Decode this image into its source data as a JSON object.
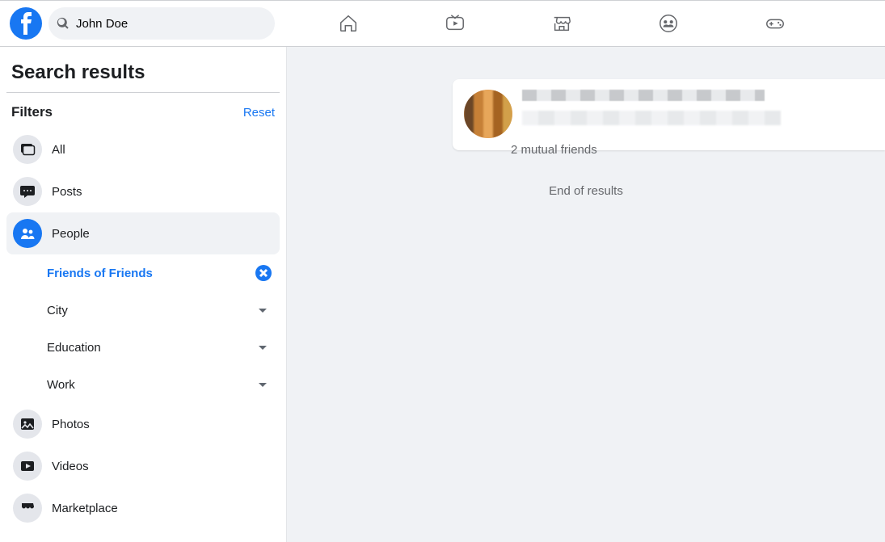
{
  "header": {
    "search_query": "John Doe"
  },
  "sidebar": {
    "title": "Search results",
    "filters_label": "Filters",
    "reset_label": "Reset",
    "items": {
      "all": "All",
      "posts": "Posts",
      "people": "People",
      "photos": "Photos",
      "videos": "Videos",
      "marketplace": "Marketplace"
    },
    "sub_filters": {
      "friends_of_friends": "Friends of Friends",
      "city": "City",
      "education": "Education",
      "work": "Work"
    }
  },
  "content": {
    "mutual_friends_text": "2 mutual friends",
    "end_of_results": "End of results"
  }
}
